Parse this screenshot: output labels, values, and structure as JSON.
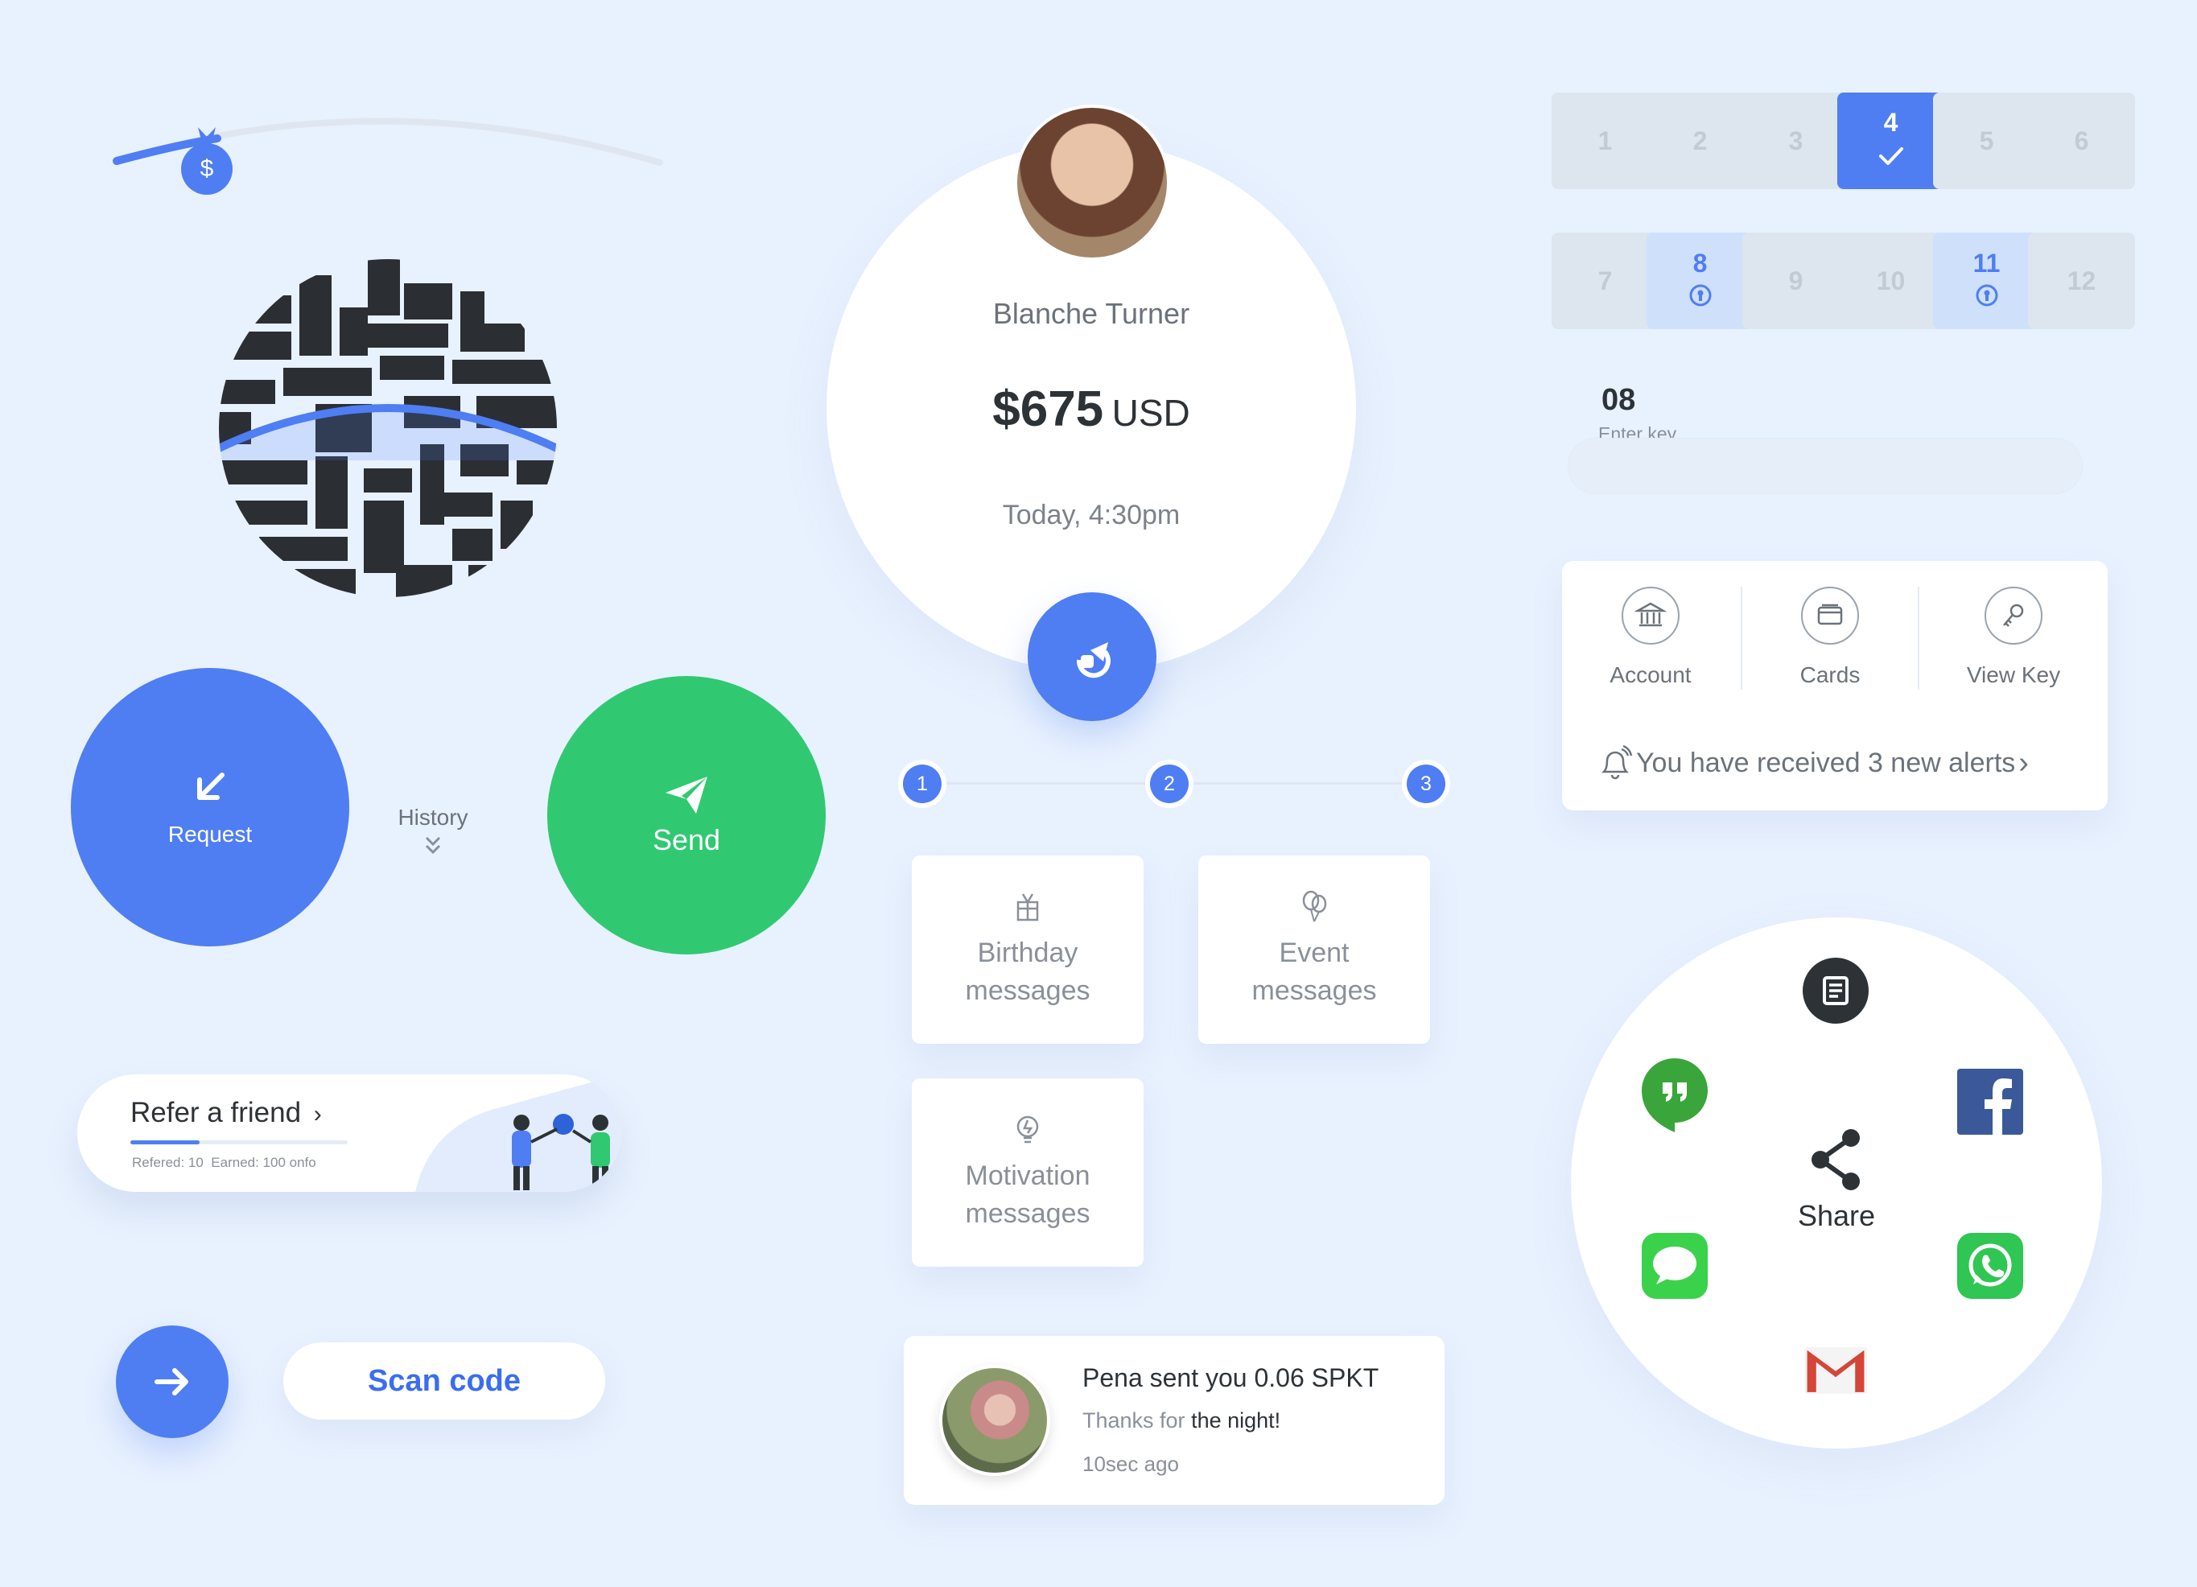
{
  "colors": {
    "background": "#e8f1fe",
    "primary_blue": "#4f7ef3",
    "send_green": "#30c971",
    "dark": "#2d3237",
    "muted": "#8a9099"
  },
  "slider": {
    "icon": "money-bag-icon",
    "symbol": "$"
  },
  "profile": {
    "name": "Blanche Turner",
    "amount": "$675",
    "currency": "USD",
    "time": "Today, 4:30pm",
    "action_icon": "transfer-icon"
  },
  "request": {
    "label": "Request",
    "icon": "arrow-down-left-icon"
  },
  "history": {
    "label": "History",
    "icon": "double-chevron-down-icon"
  },
  "send": {
    "label": "Send",
    "icon": "paper-plane-icon"
  },
  "keypad": {
    "keys": [
      {
        "label": "1",
        "state": "default"
      },
      {
        "label": "2",
        "state": "default"
      },
      {
        "label": "3",
        "state": "default"
      },
      {
        "label": "4",
        "state": "selected"
      },
      {
        "label": "5",
        "state": "default"
      },
      {
        "label": "6",
        "state": "default"
      },
      {
        "label": "7",
        "state": "default"
      },
      {
        "label": "8",
        "state": "locked"
      },
      {
        "label": "9",
        "state": "default"
      },
      {
        "label": "10",
        "state": "default"
      },
      {
        "label": "11",
        "state": "locked"
      },
      {
        "label": "12",
        "state": "default"
      }
    ],
    "value": "08",
    "hint": "Enter key"
  },
  "quick_actions": {
    "items": [
      {
        "label": "Account",
        "icon": "bank-icon"
      },
      {
        "label": "Cards",
        "icon": "cards-icon"
      },
      {
        "label": "View Key",
        "icon": "key-icon"
      }
    ],
    "alert": "You have received 3 new alerts",
    "alert_icon": "bell-icon"
  },
  "stepper": {
    "steps": [
      "1",
      "2",
      "3"
    ]
  },
  "messages": {
    "cards": [
      {
        "line1": "Birthday",
        "line2": "messages",
        "icon": "gift-icon"
      },
      {
        "line1": "Event",
        "line2": "messages",
        "icon": "balloons-icon"
      },
      {
        "line1": "Motivation",
        "line2": "messages",
        "icon": "lightbulb-icon"
      }
    ]
  },
  "refer": {
    "title": "Refer a friend",
    "stats": "Refered: 10  Earned: 100 onfo",
    "progress": 0.32
  },
  "scan": {
    "label": "Scan code",
    "go_icon": "arrow-right-icon"
  },
  "notification": {
    "title": "Pena sent you 0.06 SPKT",
    "body_prefix": "Thanks for ",
    "body_emphasis": "the night!",
    "time": "10sec ago"
  },
  "share": {
    "label": "Share",
    "icon": "share-icon",
    "apps": [
      {
        "name": "news",
        "icon": "newspaper-icon"
      },
      {
        "name": "hangouts",
        "icon": "hangouts-icon"
      },
      {
        "name": "facebook",
        "icon": "facebook-icon"
      },
      {
        "name": "messages",
        "icon": "messages-icon"
      },
      {
        "name": "whatsapp",
        "icon": "whatsapp-icon"
      },
      {
        "name": "gmail",
        "icon": "gmail-icon"
      }
    ]
  }
}
